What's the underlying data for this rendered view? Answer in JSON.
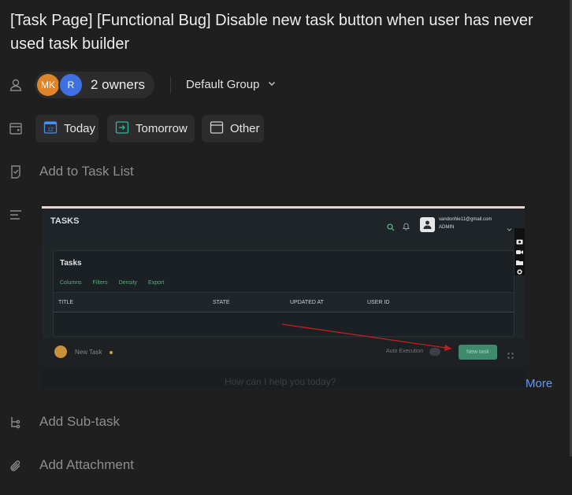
{
  "task": {
    "title": "[Task Page] [Functional Bug] Disable new task button when user has never used task builder"
  },
  "owners": {
    "avatars": [
      "MK",
      "R"
    ],
    "label": "2 owners",
    "group": "Default Group"
  },
  "dates": {
    "today": "Today",
    "today_icon_num": "12",
    "tomorrow": "Tomorrow",
    "other": "Other"
  },
  "task_list": {
    "placeholder": "Add to Task List"
  },
  "description": {
    "more_label": "More",
    "screenshot": {
      "header_title": "TASKS",
      "email": "vandonhle11@gmail.com",
      "role": "ADMIN",
      "panel_title": "Tasks",
      "toolbar": [
        "Columns",
        "Filters",
        "Density",
        "Export"
      ],
      "columns": [
        "TITLE",
        "STATE",
        "UPDATED AT",
        "USER ID"
      ],
      "new_task_label": "New Task",
      "auto_execution": "Auto Execution",
      "new_task_button": "New task",
      "prompt": "How can I help you today?"
    }
  },
  "subtask": {
    "placeholder": "Add Sub-task"
  },
  "attachment": {
    "placeholder": "Add Attachment"
  },
  "colors": {
    "accent_link": "#5b9cf5",
    "owner_mk": "#e0842a",
    "owner_r": "#3f6fe0",
    "shot_green": "#3d8a6f",
    "arrow_red": "#c02020"
  }
}
